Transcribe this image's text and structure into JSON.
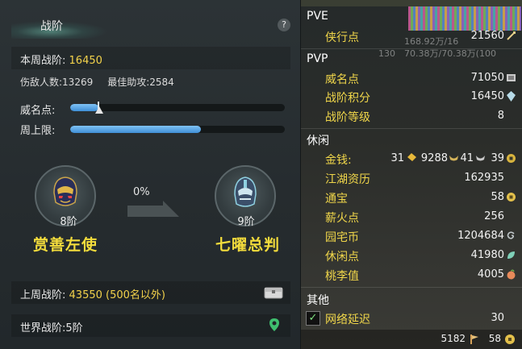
{
  "left": {
    "tab_label": "战阶",
    "help_label": "?",
    "weekly_rank_label": "本周战阶:",
    "weekly_rank_value": "16450",
    "wounded_label": "伤敌人数:",
    "wounded_value": "13269",
    "assist_label": "最佳助攻:",
    "assist_value": "2584",
    "prestige_label": "威名点:",
    "prestige_fraction": 0.13,
    "weekly_cap_label": "周上限:",
    "weekly_cap_fraction": 0.61,
    "current_tier": "8阶",
    "current_title": "赏善左使",
    "next_tier": "9阶",
    "next_title": "七曜总判",
    "progress_percent": "0%",
    "last_week_label": "上周战阶:",
    "last_week_value": "43550 (500名以外)",
    "world_rank_label": "世界战阶:",
    "world_rank_value": "5阶"
  },
  "right": {
    "pve_header": "PVE",
    "pvp_header": "PVP",
    "leisure_header": "休闲",
    "other_header": "其他",
    "ghost_1": "168.92万/16",
    "ghost_2": "70.38万/70.38万(100",
    "ghost_3": "130",
    "rows": {
      "xiaxing": {
        "label": "侠行点",
        "value": "21560"
      },
      "weiming": {
        "label": "威名点",
        "value": "71050"
      },
      "zhanjie_score": {
        "label": "战阶积分",
        "value": "16450"
      },
      "zhanjie_level": {
        "label": "战阶等级",
        "value": "8"
      },
      "money": {
        "label": "金钱:",
        "gold": "31",
        "silver": "9288",
        "copper": "41",
        "other": "39"
      },
      "jianghu": {
        "label": "江湖资历",
        "value": "162935"
      },
      "tongbao": {
        "label": "通宝",
        "value": "58"
      },
      "xinhuo": {
        "label": "薪火点",
        "value": "256"
      },
      "yuanzhai": {
        "label": "园宅币",
        "value": "1204684"
      },
      "xiuxian": {
        "label": "休闲点",
        "value": "41980"
      },
      "taoli": {
        "label": "桃李值",
        "value": "4005"
      },
      "latency": {
        "label": "网络延迟",
        "value": "30"
      }
    },
    "footer_left": "5182",
    "footer_right": "58"
  },
  "colors": {
    "accent_gold": "#f3d24b",
    "bar_blue": "#4a9be0",
    "title_yellow": "#f3dc3c"
  }
}
